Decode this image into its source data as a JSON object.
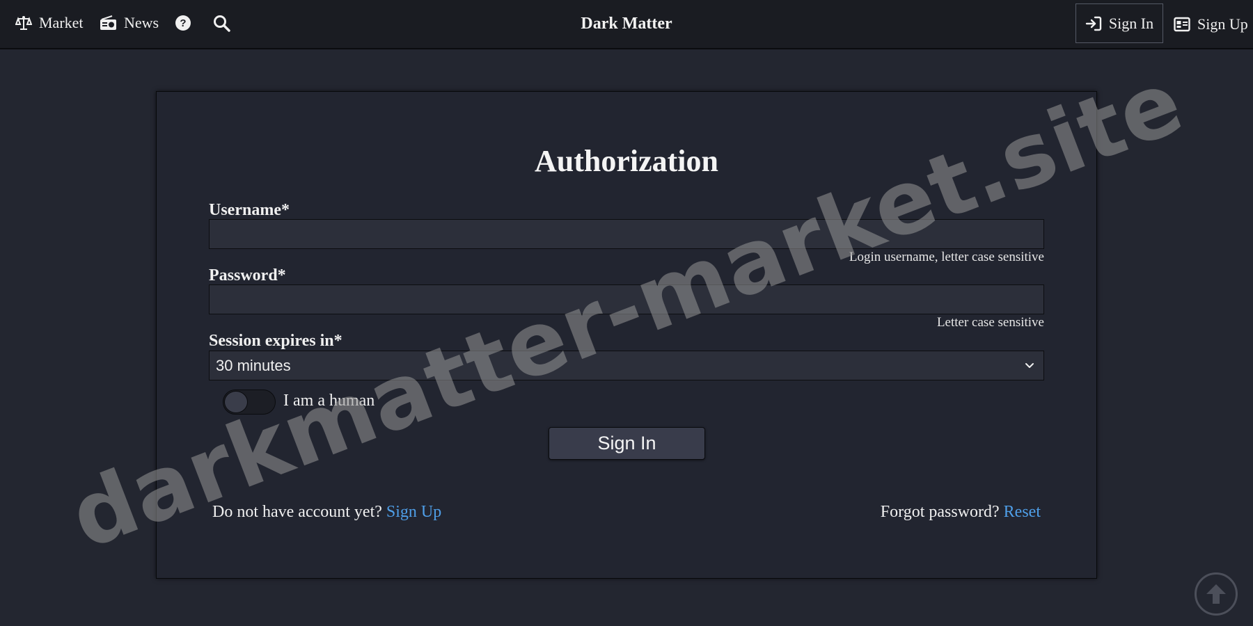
{
  "navbar": {
    "market_label": "Market",
    "news_label": "News",
    "brand": "Dark Matter",
    "signin_label": "Sign In",
    "signup_label": "Sign Up"
  },
  "form": {
    "title": "Authorization",
    "username_label": "Username*",
    "username_value": "",
    "username_hint": "Login username, letter case sensitive",
    "password_label": "Password*",
    "password_value": "",
    "password_hint": "Letter case sensitive",
    "session_label": "Session expires in*",
    "session_selected": "30 minutes",
    "human_label": "I am a human",
    "human_checked": false,
    "submit_label": "Sign In",
    "no_account_text": "Do not have account yet?",
    "signup_link": "Sign Up",
    "forgot_text": "Forgot password?",
    "reset_link": "Reset"
  },
  "watermark": "darkmatter-market.site",
  "icons": {
    "market": "scale-balance-icon",
    "news": "radio-icon",
    "help": "question-circle-icon",
    "search": "search-icon",
    "signin": "sign-in-arrow-icon",
    "signup": "id-card-icon",
    "select": "chevron-down-icon",
    "scroll_top": "arrow-up-circle-icon"
  },
  "colors": {
    "background": "#232630",
    "navbar": "#1a1c22",
    "link": "#4f9fe8",
    "watermark": "#969696"
  }
}
